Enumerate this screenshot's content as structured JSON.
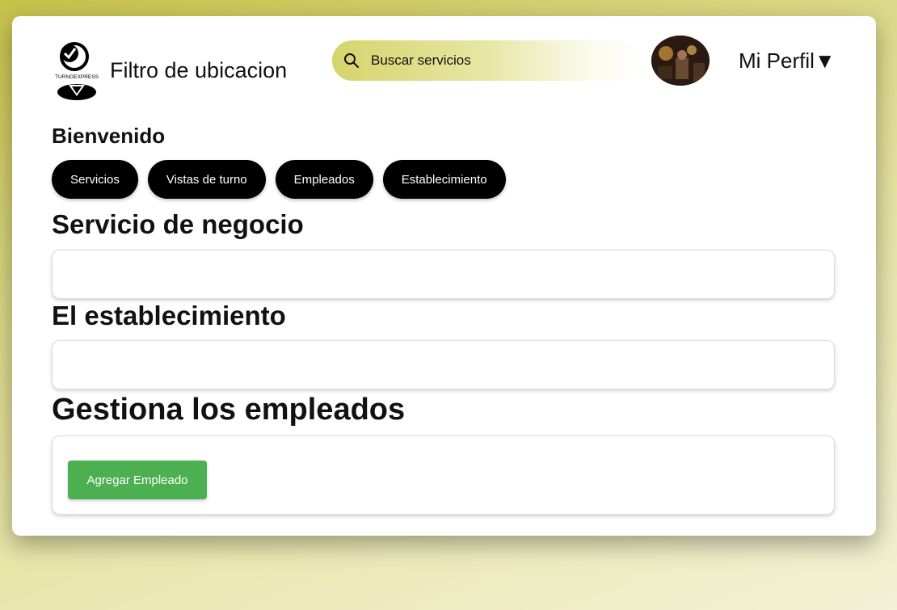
{
  "header": {
    "logo_text": "TURNOEXPRESS",
    "location_filter": "Filtro de ubicacion",
    "search_placeholder": "Buscar servicios",
    "profile_label": "Mi Perfil▼"
  },
  "welcome": "Bienvenido",
  "nav": {
    "items": [
      {
        "label": "Servicios"
      },
      {
        "label": "Vistas de turno"
      },
      {
        "label": "Empleados"
      },
      {
        "label": "Establecimiento"
      }
    ]
  },
  "sections": {
    "business_service": {
      "title": "Servicio de negocio",
      "value": ""
    },
    "establishment": {
      "title": "El establecimiento",
      "value": ""
    },
    "employees": {
      "title": "Gestiona los empleados",
      "add_button": "Agregar Empleado"
    }
  },
  "colors": {
    "accent_green": "#4caf50",
    "pill_black": "#000000",
    "search_gradient_start": "#d6d46c"
  },
  "icons": {
    "search": "search-icon",
    "logo": "turnoexpress-logo"
  }
}
